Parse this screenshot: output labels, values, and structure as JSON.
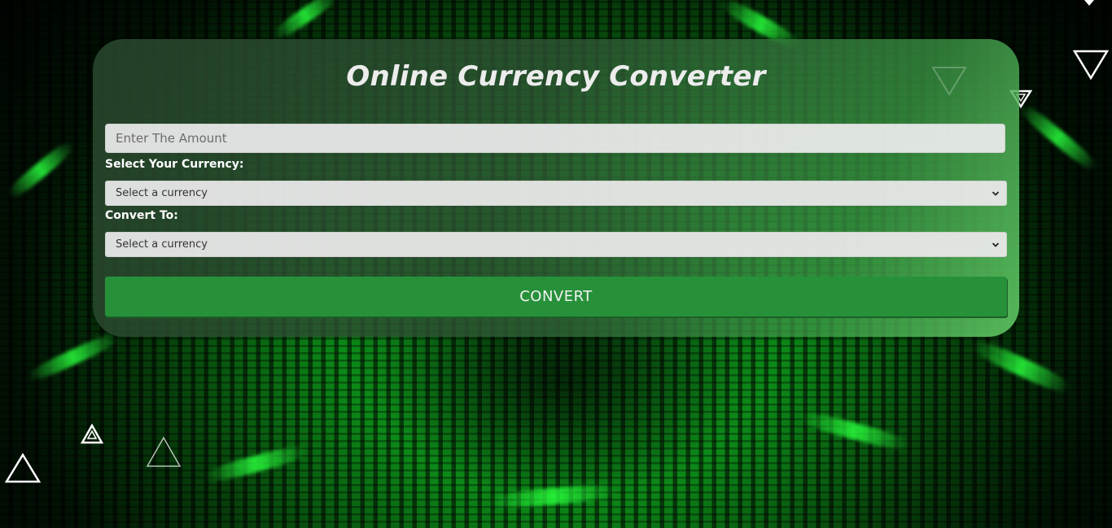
{
  "title": "Online Currency Converter",
  "amount_input": {
    "placeholder": "Enter The Amount",
    "value": ""
  },
  "from_currency": {
    "label": "Select Your Currency:",
    "selected": "Select a currency"
  },
  "to_currency": {
    "label": "Convert To:",
    "selected": "Select a currency"
  },
  "convert_button": {
    "label": "CONVERT"
  },
  "colors": {
    "button": "#27913a",
    "background_accent": "#0c8a18",
    "card_tint": "#2d5032"
  },
  "decorations": {
    "icon": "triangle-outline-icon"
  }
}
